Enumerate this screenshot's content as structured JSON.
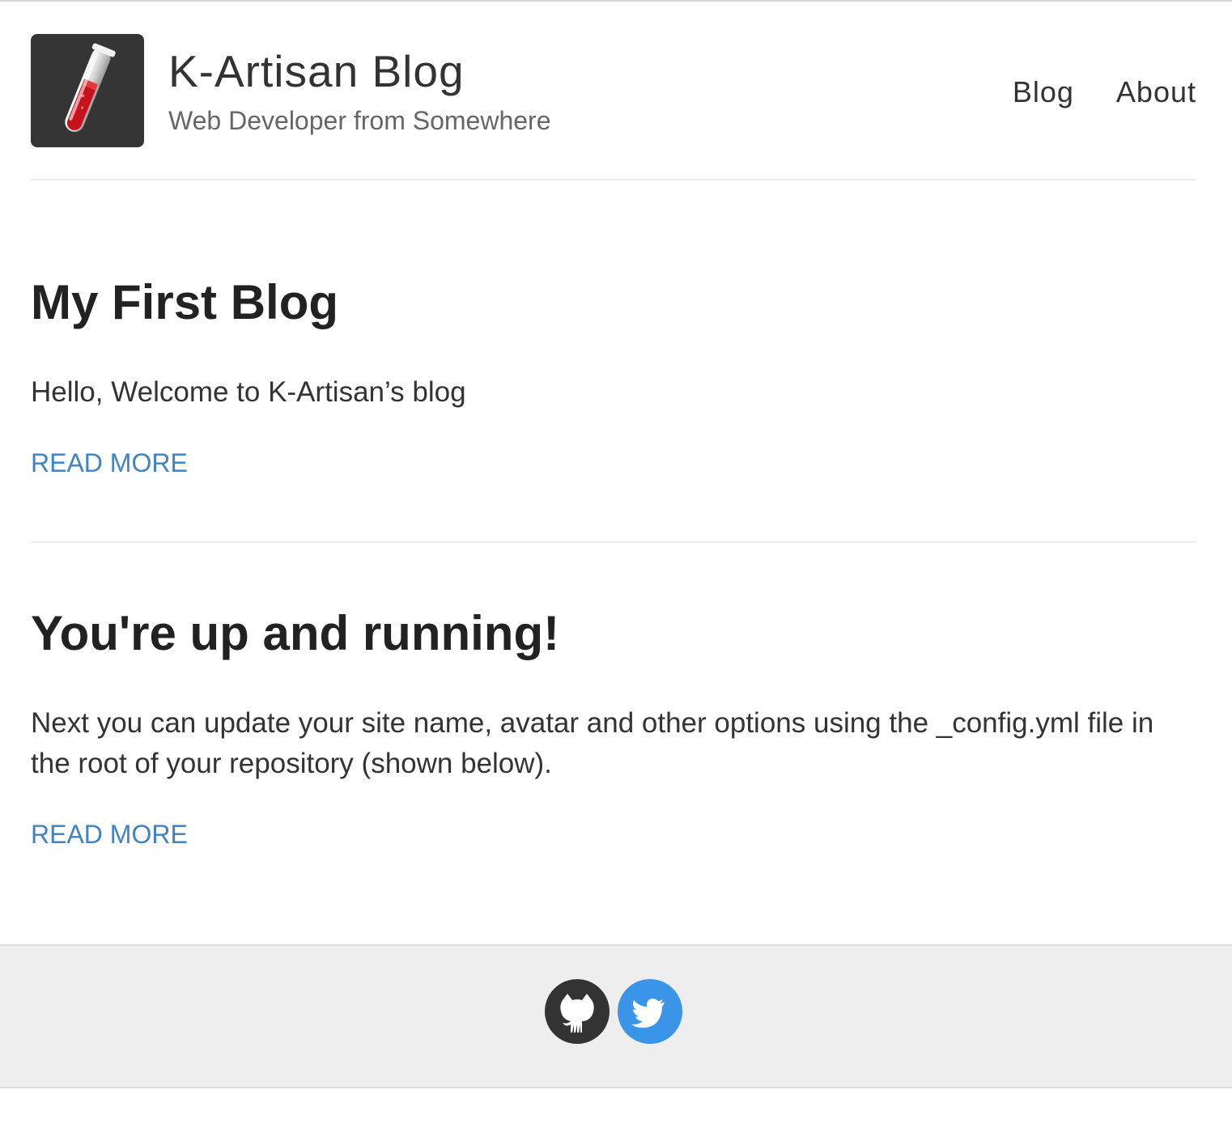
{
  "site": {
    "name": "K-Artisan Blog",
    "description": "Web Developer from Somewhere"
  },
  "nav": {
    "items": [
      {
        "label": "Blog"
      },
      {
        "label": "About"
      }
    ]
  },
  "posts": [
    {
      "title": "My First Blog",
      "excerpt": "Hello, Welcome to K-Artisan’s blog",
      "read_more": "READ MORE"
    },
    {
      "title": "You're up and running!",
      "excerpt": "Next you can update your site name, avatar and other options using the _config.yml file in the root of your repository (shown below).",
      "read_more": "READ MORE"
    }
  ],
  "footer": {
    "social": [
      {
        "icon": "github-icon",
        "color": "#333333"
      },
      {
        "icon": "twitter-icon",
        "color": "#3a94e8"
      }
    ]
  },
  "colors": {
    "link": "#4183c4",
    "avatar_bg": "#353535",
    "footer_bg": "#eeeeee"
  }
}
